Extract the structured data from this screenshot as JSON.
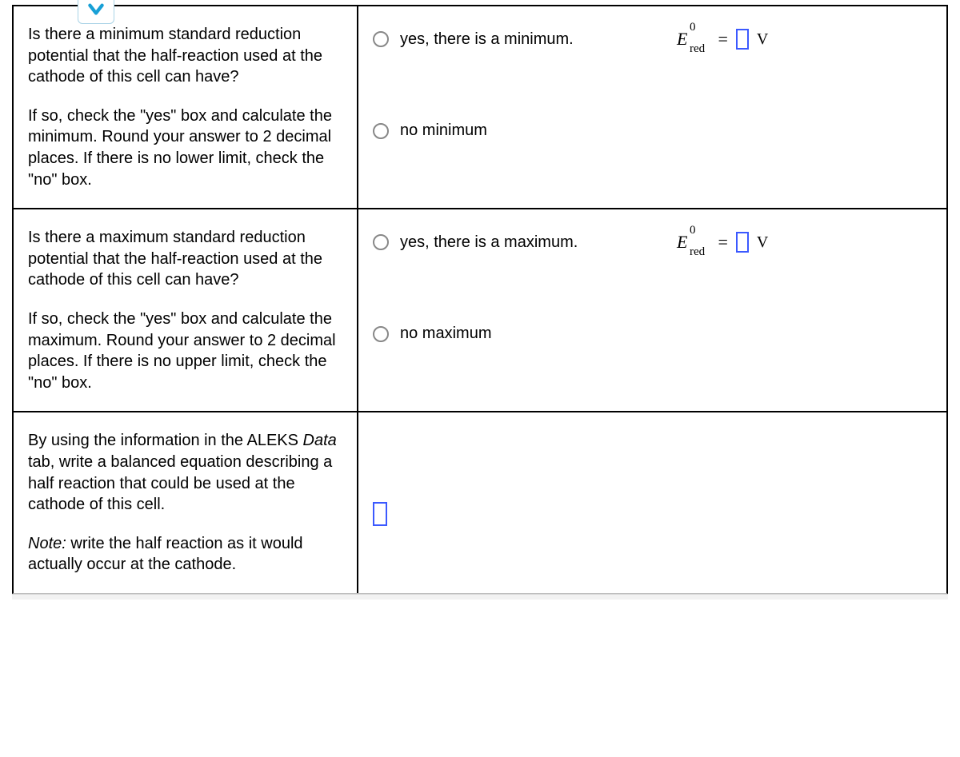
{
  "row1": {
    "q_p1": "Is there a minimum standard reduction potential that the half-reaction used at the cathode of this cell can have?",
    "q_p2": "If so, check the \"yes\" box and calculate the minimum. Round your answer to 2 decimal places. If there is no lower limit, check the \"no\" box.",
    "opt_yes": "yes, there is a minimum.",
    "opt_no": "no minimum"
  },
  "row2": {
    "q_p1": "Is there a maximum standard reduction potential that the half-reaction used at the cathode of this cell can have?",
    "q_p2": "If so, check the \"yes\" box and calculate the maximum. Round your answer to 2 decimal places. If there is no upper limit, check the \"no\" box.",
    "opt_yes": "yes, there is a maximum.",
    "opt_no": "no maximum"
  },
  "row3": {
    "q_pre": "By using the information in the ALEKS ",
    "q_ital": "Data",
    "q_post": " tab, write a balanced equation describing a half reaction that could be used at the cathode of this cell.",
    "note_ital": "Note:",
    "note_rest": " write the half reaction as it would actually occur at the cathode."
  },
  "formula": {
    "E": "E",
    "sup": "0",
    "sub": "red",
    "eq": "=",
    "unit": "V"
  }
}
